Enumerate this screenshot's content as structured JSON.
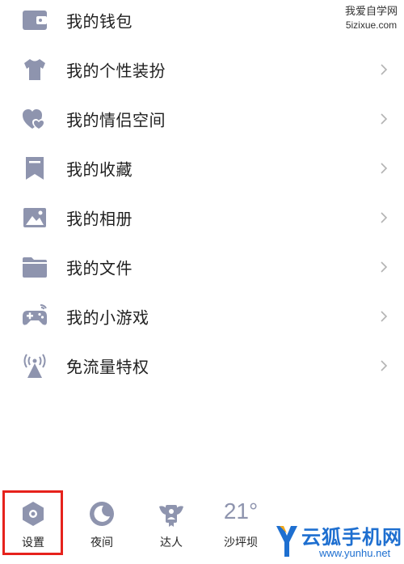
{
  "watermark_top": {
    "line1": "我爱自学网",
    "line2": "5izixue.com"
  },
  "menu": {
    "items": [
      {
        "label": "我的钱包",
        "icon": "wallet-icon",
        "chevron": false
      },
      {
        "label": "我的个性装扮",
        "icon": "tshirt-icon",
        "chevron": true
      },
      {
        "label": "我的情侣空间",
        "icon": "couple-hearts-icon",
        "chevron": true
      },
      {
        "label": "我的收藏",
        "icon": "bookmark-icon",
        "chevron": true
      },
      {
        "label": "我的相册",
        "icon": "photo-album-icon",
        "chevron": true
      },
      {
        "label": "我的文件",
        "icon": "folder-icon",
        "chevron": true
      },
      {
        "label": "我的小游戏",
        "icon": "gamepad-icon",
        "chevron": true
      },
      {
        "label": "免流量特权",
        "icon": "signal-tower-icon",
        "chevron": true
      }
    ]
  },
  "bottom_bar": {
    "settings_label": "设置",
    "night_label": "夜间",
    "expert_label": "达人",
    "weather_temp": "21°",
    "weather_city": "沙坪坝"
  },
  "brand_watermark": {
    "name": "云狐手机网",
    "url": "www.yunhu.net"
  },
  "colors": {
    "icon": "#8e94ae",
    "text": "#1f1f1f",
    "highlight": "#e6221c",
    "brand": "#1e6fd0"
  }
}
